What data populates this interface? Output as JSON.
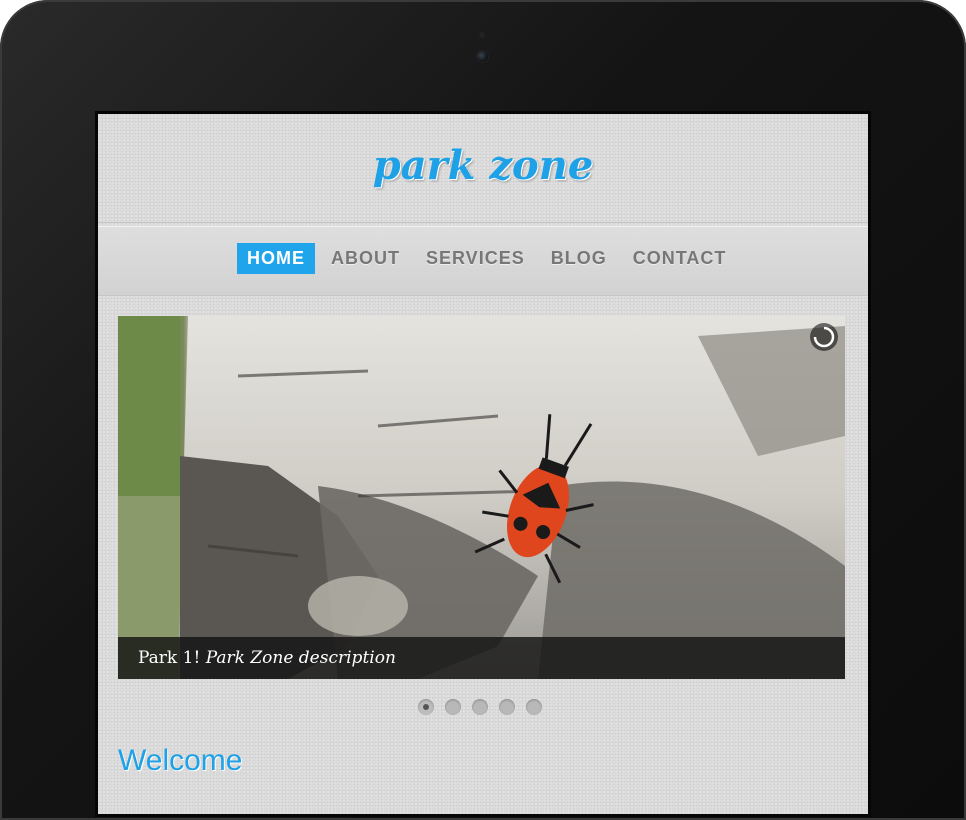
{
  "site": {
    "logo": "park zone",
    "brand_color": "#1ea1e6"
  },
  "nav": {
    "items": [
      {
        "label": "HOME",
        "active": true
      },
      {
        "label": "ABOUT",
        "active": false
      },
      {
        "label": "SERVICES",
        "active": false
      },
      {
        "label": "BLOG",
        "active": false
      },
      {
        "label": "CONTACT",
        "active": false
      }
    ]
  },
  "slider": {
    "caption_title": "Park 1!",
    "caption_desc": "Park Zone description",
    "image_subject": "red firebug on birch tree bark",
    "current_slide": 1,
    "slide_count": 5
  },
  "content": {
    "heading": "Welcome"
  },
  "icons": {
    "loader": "loading-spinner-icon"
  }
}
